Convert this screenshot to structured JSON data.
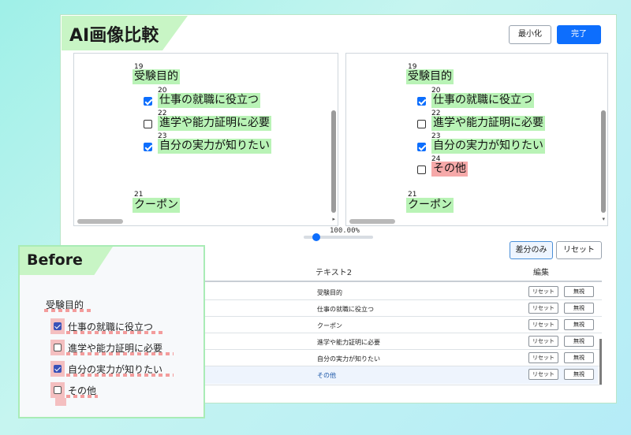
{
  "window": {
    "title": "AI画像比較",
    "minimize_label": "最小化",
    "done_label": "完了"
  },
  "left_pane": {
    "parent": {
      "num": "19",
      "text": "受験目的"
    },
    "items": [
      {
        "num": "20",
        "text": "仕事の就職に役立つ",
        "checked": true
      },
      {
        "num": "22",
        "text": "進学や能力証明に必要",
        "checked": false
      },
      {
        "num": "23",
        "text": "自分の実力が知りたい",
        "checked": true
      }
    ],
    "coupon": {
      "num": "21",
      "text": "クーポン"
    }
  },
  "right_pane": {
    "parent": {
      "num": "19",
      "text": "受験目的"
    },
    "items": [
      {
        "num": "20",
        "text": "仕事の就職に役立つ",
        "checked": true
      },
      {
        "num": "22",
        "text": "進学や能力証明に必要",
        "checked": false
      },
      {
        "num": "23",
        "text": "自分の実力が知りたい",
        "checked": true
      },
      {
        "num": "24",
        "text": "その他",
        "checked": false,
        "diff": true
      }
    ],
    "coupon": {
      "num": "21",
      "text": "クーポン"
    }
  },
  "zoom": {
    "label": "100.00%",
    "level": 0.15
  },
  "filters": {
    "diff_only_label": "差分のみ",
    "reset_label": "リセット"
  },
  "table": {
    "headers": {
      "text2": "テキスト2",
      "edit": "編集"
    },
    "rows": [
      {
        "text2": "受験目的",
        "reset": "リセット",
        "ignore": "無視"
      },
      {
        "text2": "仕事の就職に役立つ",
        "reset": "リセット",
        "ignore": "無視"
      },
      {
        "text2": "クーポン",
        "reset": "リセット",
        "ignore": "無視"
      },
      {
        "text2": "進学や能力証明に必要",
        "reset": "リセット",
        "ignore": "無視"
      },
      {
        "text2": "自分の実力が知りたい",
        "reset": "リセット",
        "ignore": "無視"
      },
      {
        "text2": "その他",
        "reset": "リセット",
        "ignore": "無視",
        "highlight": true
      }
    ]
  },
  "before": {
    "title": "Before",
    "parent": "受験目的",
    "items": [
      {
        "text": "仕事の就職に役立つ",
        "checked": true
      },
      {
        "text": "進学や能力証明に必要",
        "checked": false
      },
      {
        "text": "自分の実力が知りたい",
        "checked": true
      },
      {
        "text": "その他",
        "checked": false
      }
    ]
  },
  "colors": {
    "accent": "#0d6efd",
    "match_highlight": "#b9f3b6",
    "diff_highlight": "#f6a9a9"
  }
}
